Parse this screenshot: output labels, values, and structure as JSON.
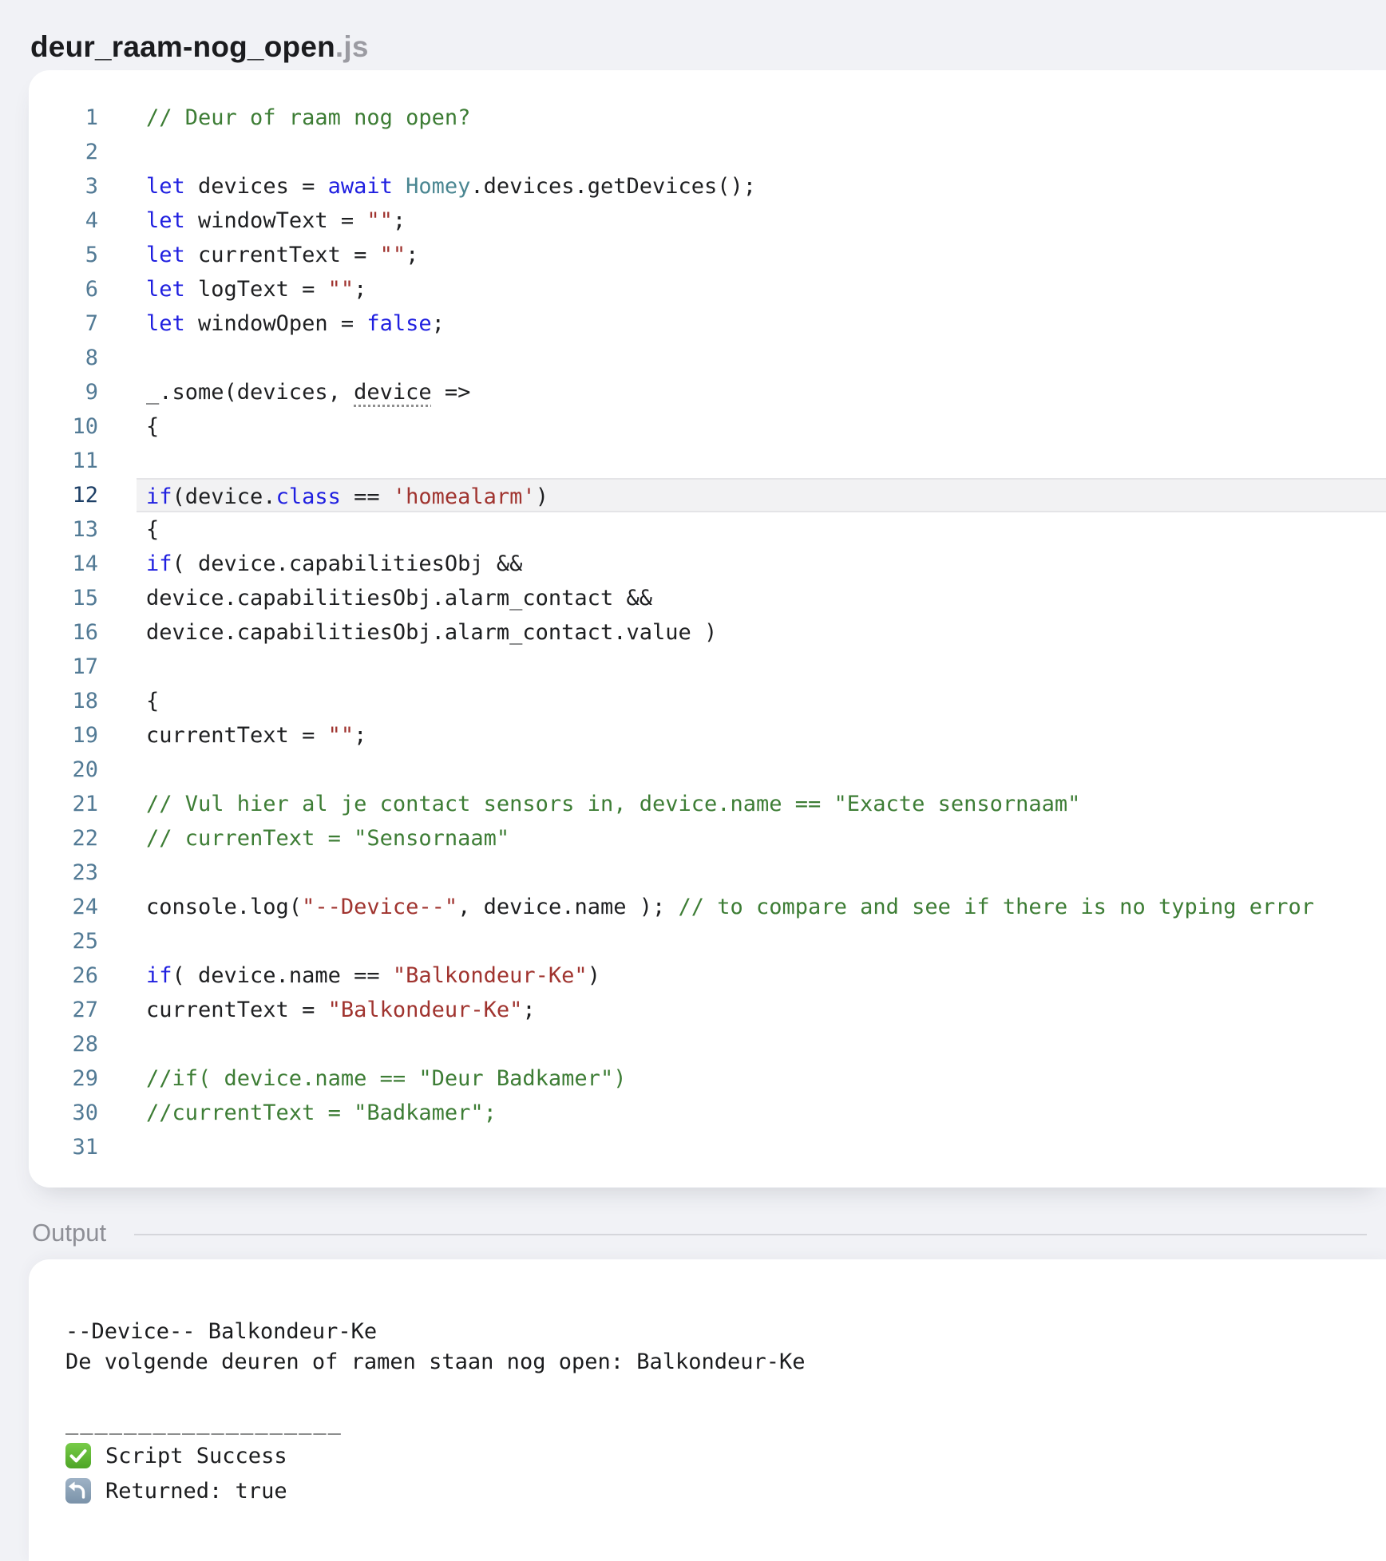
{
  "window": {
    "title_name": "deur_raam-nog_open",
    "title_ext": ".js"
  },
  "editor": {
    "active_line": 12,
    "lines": [
      {
        "n": 1,
        "tokens": [
          [
            "c",
            "// Deur of raam nog open?"
          ]
        ]
      },
      {
        "n": 2,
        "tokens": []
      },
      {
        "n": 3,
        "tokens": [
          [
            "k",
            "let"
          ],
          [
            "p",
            " devices = "
          ],
          [
            "k",
            "await"
          ],
          [
            "p",
            " "
          ],
          [
            "t",
            "Homey"
          ],
          [
            "p",
            ".devices.getDevices();"
          ]
        ]
      },
      {
        "n": 4,
        "tokens": [
          [
            "k",
            "let"
          ],
          [
            "p",
            " windowText = "
          ],
          [
            "s",
            "\"\""
          ],
          [
            "p",
            ";"
          ]
        ]
      },
      {
        "n": 5,
        "tokens": [
          [
            "k",
            "let"
          ],
          [
            "p",
            " currentText = "
          ],
          [
            "s",
            "\"\""
          ],
          [
            "p",
            ";"
          ]
        ]
      },
      {
        "n": 6,
        "tokens": [
          [
            "k",
            "let"
          ],
          [
            "p",
            " logText = "
          ],
          [
            "s",
            "\"\""
          ],
          [
            "p",
            ";"
          ]
        ]
      },
      {
        "n": 7,
        "tokens": [
          [
            "k",
            "let"
          ],
          [
            "p",
            " windowOpen = "
          ],
          [
            "k",
            "false"
          ],
          [
            "p",
            ";"
          ]
        ]
      },
      {
        "n": 8,
        "tokens": []
      },
      {
        "n": 9,
        "tokens": [
          [
            "p",
            "_.some(devices, "
          ],
          [
            "u",
            "device"
          ],
          [
            "p",
            " =>"
          ]
        ]
      },
      {
        "n": 10,
        "tokens": [
          [
            "p",
            "{"
          ]
        ]
      },
      {
        "n": 11,
        "tokens": []
      },
      {
        "n": 12,
        "hl": true,
        "tokens": [
          [
            "k",
            "if"
          ],
          [
            "p",
            "(device."
          ],
          [
            "k",
            "class"
          ],
          [
            "p",
            " == "
          ],
          [
            "s",
            "'homealarm'"
          ],
          [
            "p",
            ")"
          ]
        ]
      },
      {
        "n": 13,
        "tokens": [
          [
            "p",
            "{"
          ]
        ]
      },
      {
        "n": 14,
        "tokens": [
          [
            "k",
            "if"
          ],
          [
            "p",
            "( device.capabilitiesObj &&"
          ]
        ]
      },
      {
        "n": 15,
        "tokens": [
          [
            "p",
            "device.capabilitiesObj.alarm_contact &&"
          ]
        ]
      },
      {
        "n": 16,
        "tokens": [
          [
            "p",
            "device.capabilitiesObj.alarm_contact.value )"
          ]
        ]
      },
      {
        "n": 17,
        "tokens": []
      },
      {
        "n": 18,
        "tokens": [
          [
            "p",
            "{"
          ]
        ]
      },
      {
        "n": 19,
        "tokens": [
          [
            "p",
            "currentText = "
          ],
          [
            "s",
            "\"\""
          ],
          [
            "p",
            ";"
          ]
        ]
      },
      {
        "n": 20,
        "tokens": []
      },
      {
        "n": 21,
        "tokens": [
          [
            "c",
            "// Vul hier al je contact sensors in, device.name == \"Exacte sensornaam\""
          ]
        ]
      },
      {
        "n": 22,
        "tokens": [
          [
            "c",
            "// currenText = \"Sensornaam\""
          ]
        ]
      },
      {
        "n": 23,
        "tokens": []
      },
      {
        "n": 24,
        "tokens": [
          [
            "p",
            "console.log("
          ],
          [
            "s",
            "\"--Device--\""
          ],
          [
            "p",
            ", device.name ); "
          ],
          [
            "c",
            "// to compare and see if there is no typing error"
          ]
        ]
      },
      {
        "n": 25,
        "tokens": []
      },
      {
        "n": 26,
        "tokens": [
          [
            "k",
            "if"
          ],
          [
            "p",
            "( device.name == "
          ],
          [
            "s",
            "\"Balkondeur-Ke\""
          ],
          [
            "p",
            ")"
          ]
        ]
      },
      {
        "n": 27,
        "tokens": [
          [
            "p",
            "currentText = "
          ],
          [
            "s",
            "\"Balkondeur-Ke\""
          ],
          [
            "p",
            ";"
          ]
        ]
      },
      {
        "n": 28,
        "tokens": []
      },
      {
        "n": 29,
        "tokens": [
          [
            "c",
            "//if( device.name == \"Deur Badkamer\")"
          ]
        ]
      },
      {
        "n": 30,
        "tokens": [
          [
            "c",
            "//currentText = \"Badkamer\";"
          ]
        ]
      },
      {
        "n": 31,
        "tokens": []
      }
    ]
  },
  "output": {
    "label": "Output",
    "lines": [
      "--Device-- Balkondeur-Ke",
      "De volgende deuren of ramen staan nog open: Balkondeur-Ke",
      ""
    ],
    "separator": "___________________",
    "status": [
      {
        "icon": "check-icon",
        "text": "Script Success"
      },
      {
        "icon": "return-icon",
        "text": "Returned: true"
      }
    ]
  },
  "colors": {
    "keyword": "#1f1fe0",
    "homey_identifier": "#4a8691",
    "string": "#a0342f",
    "comment": "#3d7d35",
    "code_text": "#1e1f21",
    "line_number": "#527a95",
    "active_line_number": "#1d3f66",
    "active_line_bg": "#f2f2f3",
    "page_bg": "#f1f2f6",
    "panel_bg": "#ffffff",
    "check_green": "#5cb130",
    "return_blue_gray": "#8ba2b7"
  }
}
